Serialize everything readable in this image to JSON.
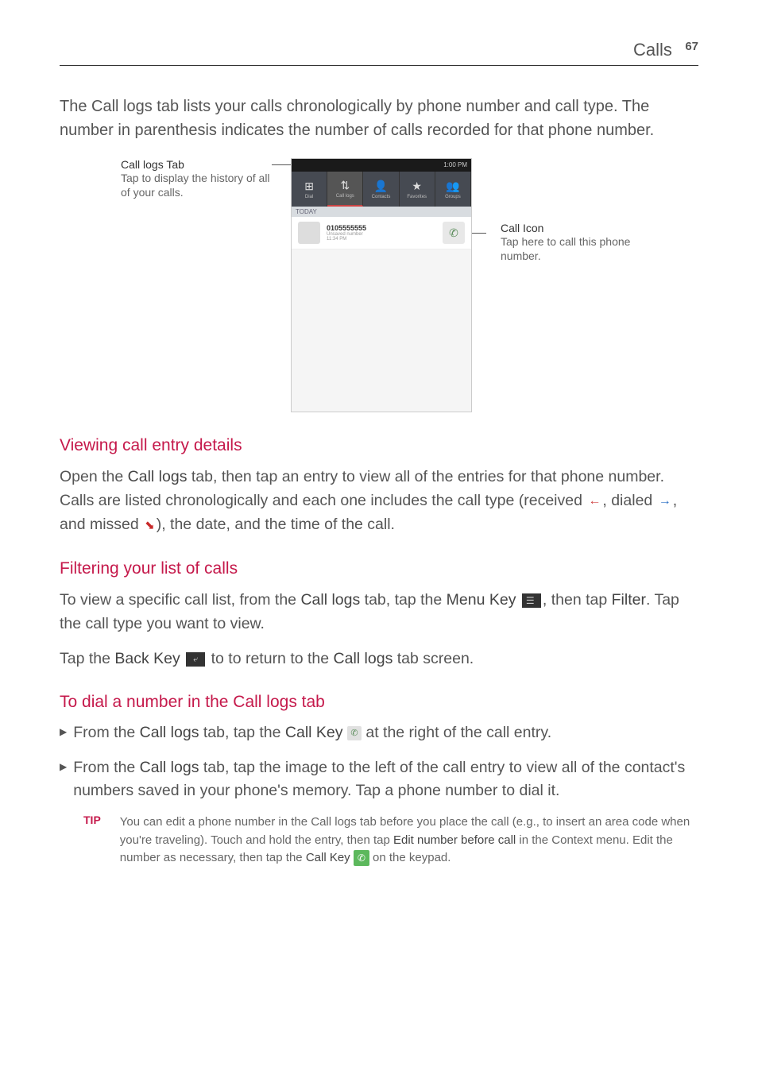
{
  "header": {
    "title": "Calls",
    "page": "67"
  },
  "intro": "The Call logs tab lists your calls chronologically by phone number and call type. The number in parenthesis indicates the number of calls recorded for that phone number.",
  "diagram": {
    "left": {
      "title": "Call logs Tab",
      "desc": "Tap to display the history of all of your calls."
    },
    "right": {
      "title": "Call Icon",
      "desc": "Tap here to call this phone number."
    },
    "phone": {
      "statusTime": "1:00 PM",
      "tabs": [
        "Dial",
        "Call logs",
        "Contacts",
        "Favorites",
        "Groups"
      ],
      "sectionLabel": "TODAY",
      "callNumber": "0105555555",
      "callSub1": "Unsaved number",
      "callSub2": "11:34 PM"
    }
  },
  "sections": {
    "viewing": {
      "heading": "Viewing call entry details",
      "p1a": "Open the ",
      "p1b": "Call logs",
      "p1c": " tab, then tap an entry to view all of the entries for that phone number. Calls are listed chronologically and each one includes the call type (received ",
      "p1d": ", dialed ",
      "p1e": ", and missed ",
      "p1f": "), the date, and the time of the call."
    },
    "filtering": {
      "heading": "Filtering your list of calls",
      "p1a": "To view a specific call list, from the ",
      "p1b": "Call logs",
      "p1c": " tab, tap the ",
      "p1d": "Menu Key",
      "p1e": ", then tap ",
      "p1f": "Filter",
      "p1g": ". Tap the call type you want to view.",
      "p2a": "Tap the ",
      "p2b": "Back Key",
      "p2c": " to to return to the ",
      "p2d": "Call logs",
      "p2e": " tab screen."
    },
    "dial": {
      "heading": "To dial a number in the Call logs tab",
      "b1a": "From the ",
      "b1b": "Call logs",
      "b1c": " tab, tap the ",
      "b1d": "Call Key",
      "b1e": " at the right of the call entry.",
      "b2a": "From the ",
      "b2b": "Call logs",
      "b2c": " tab, tap the image to the left of the call entry to view all of the contact's numbers saved in your phone's memory. Tap a phone number to dial it."
    },
    "tip": {
      "label": "TIP",
      "t1": "You can edit a phone number in the Call logs tab before you place the call (e.g., to insert an area code when you're traveling). Touch and hold the entry, then tap ",
      "t2": "Edit number before call",
      "t3": " in the Context menu. Edit the number as necessary, then tap the ",
      "t4": "Call Key",
      "t5": " on the keypad."
    }
  }
}
